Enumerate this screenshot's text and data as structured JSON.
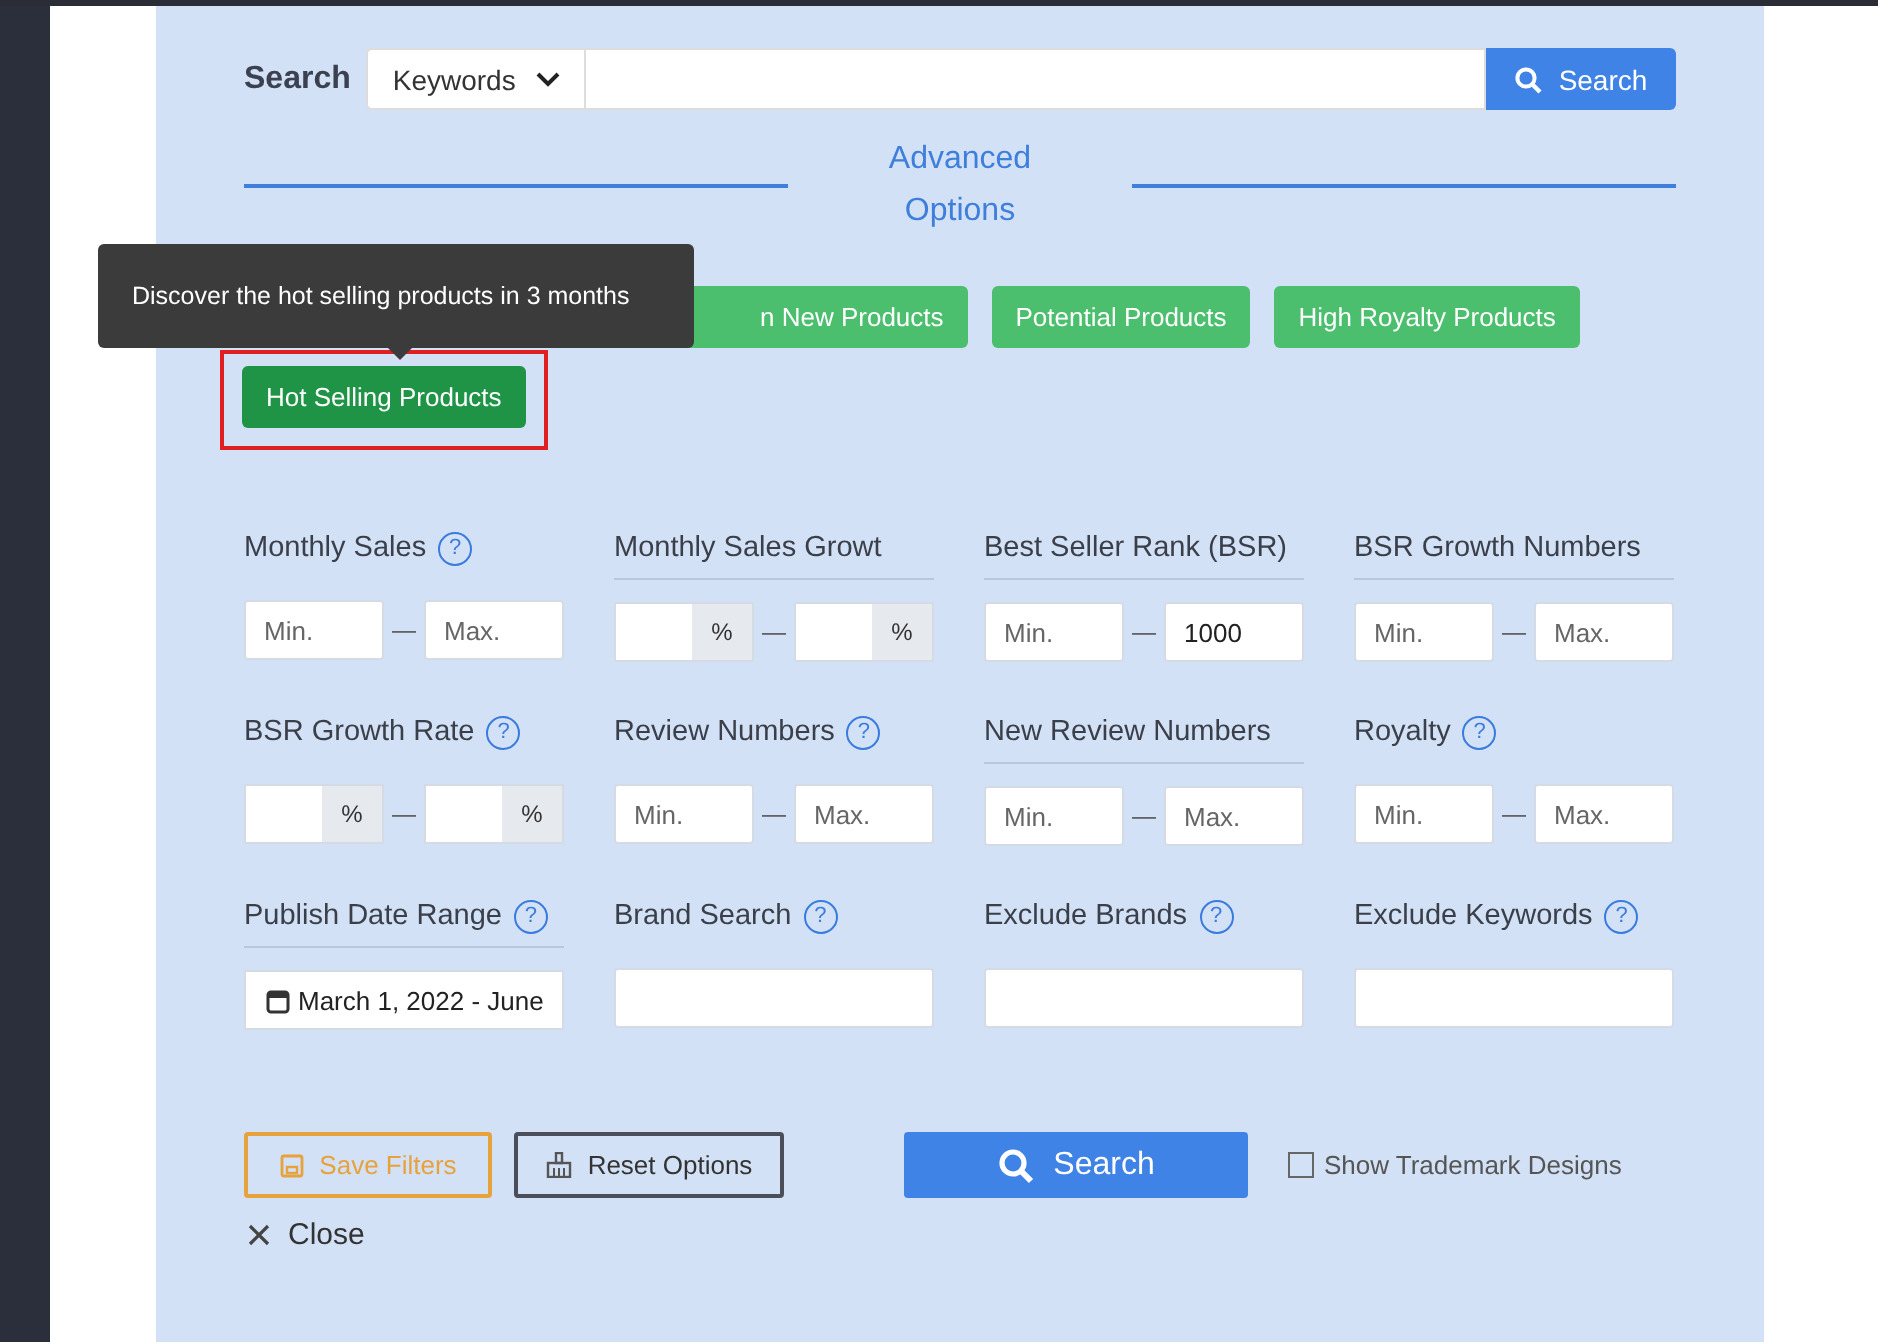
{
  "search": {
    "label": "Search",
    "scope": "Keywords",
    "button": "Search"
  },
  "advanced": {
    "title_lines": [
      "Advanced",
      "Options"
    ]
  },
  "tooltip": {
    "text": "Discover the hot selling products in 3 months"
  },
  "presets": [
    {
      "kind": "library"
    },
    {
      "kind": "preset",
      "label": "n New Products",
      "selected": false,
      "highlighted": false
    },
    {
      "kind": "preset",
      "label": "Potential Products",
      "selected": false,
      "highlighted": false
    },
    {
      "kind": "preset",
      "label": "High Royalty Products",
      "selected": false,
      "highlighted": false
    },
    {
      "kind": "preset",
      "label": "Hot Selling Products",
      "selected": true,
      "highlighted": true
    }
  ],
  "filters": [
    {
      "label": "Monthly Sales",
      "help": "?",
      "kind": "range",
      "min": {
        "placeholder": "Min."
      },
      "separator": "—",
      "max": {
        "placeholder": "Max."
      }
    },
    {
      "label": "Monthly Sales Growt",
      "kind": "percent",
      "unit": "%",
      "separator": "—"
    },
    {
      "label": "Best Seller Rank (BSR)",
      "kind": "range",
      "min": {
        "placeholder": "Min."
      },
      "separator": "—",
      "max": {
        "value": "1000"
      }
    },
    {
      "label": "BSR Growth Numbers",
      "kind": "range",
      "min": {
        "placeholder": "Min."
      },
      "separator": "—",
      "max": {
        "placeholder": "Max."
      }
    },
    {
      "label": "BSR Growth Rate",
      "help": "?",
      "kind": "percent",
      "unit": "%",
      "separator": "—"
    },
    {
      "label": "Review Numbers",
      "help": "?",
      "kind": "range",
      "min": {
        "placeholder": "Min."
      },
      "separator": "—",
      "max": {
        "placeholder": "Max."
      }
    },
    {
      "label": "New Review Numbers",
      "kind": "range",
      "min": {
        "placeholder": "Min."
      },
      "separator": "—",
      "max": {
        "placeholder": "Max."
      }
    },
    {
      "label": "Royalty",
      "help": "?",
      "kind": "range",
      "min": {
        "placeholder": "Min."
      },
      "separator": "—",
      "max": {
        "placeholder": "Max."
      }
    },
    {
      "label": "Publish Date Range",
      "help": "?",
      "kind": "date",
      "value": "March 1, 2022 - June"
    },
    {
      "label": "Brand Search",
      "help": "?",
      "kind": "text"
    },
    {
      "label": "Exclude Brands",
      "help": "?",
      "kind": "text"
    },
    {
      "label": "Exclude Keywords",
      "help": "?",
      "kind": "text"
    }
  ],
  "actions": {
    "save": "Save Filters",
    "reset": "Reset Options",
    "search": "Search",
    "trademark": {
      "label": "Show Trademark Designs",
      "checked": false
    },
    "close": "Close"
  }
}
